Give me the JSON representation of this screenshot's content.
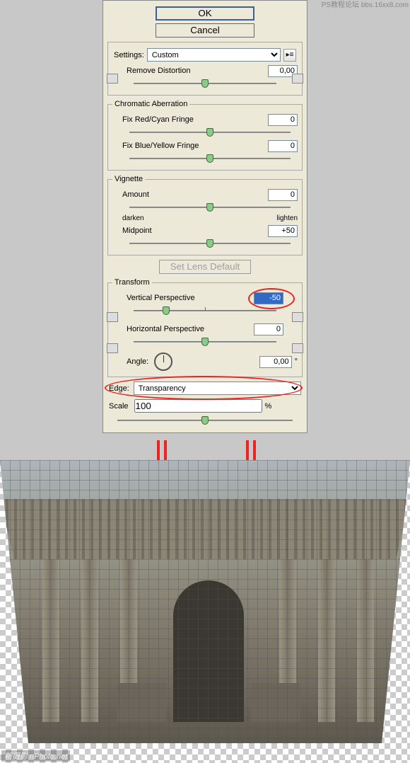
{
  "watermark_top": "PS教程论坛\nbbs.16xx8.com",
  "watermark_bottom": "新摄影 nPhoto.net",
  "buttons": {
    "ok": "OK",
    "cancel": "Cancel"
  },
  "settings": {
    "label": "Settings:",
    "value": "Custom",
    "remove_distortion_label": "Remove Distortion",
    "remove_distortion_value": "0,00"
  },
  "chromatic": {
    "legend": "Chromatic Aberration",
    "red_label": "Fix Red/Cyan Fringe",
    "red_value": "0",
    "blue_label": "Fix Blue/Yellow Fringe",
    "blue_value": "0"
  },
  "vignette": {
    "legend": "Vignette",
    "amount_label": "Amount",
    "amount_value": "0",
    "darken": "darken",
    "lighten": "lighten",
    "midpoint_label": "Midpoint",
    "midpoint_value": "+50"
  },
  "lens_default": "Set Lens Default",
  "transform": {
    "legend": "Transform",
    "vpersp_label": "Vertical Perspective",
    "vpersp_value": "-50",
    "hpersp_label": "Horizontal Perspective",
    "hpersp_value": "0",
    "angle_label": "Angle:",
    "angle_value": "0,00",
    "angle_unit": "°"
  },
  "edge": {
    "label": "Edge:",
    "value": "Transparency"
  },
  "scale": {
    "label": "Scale",
    "value": "100",
    "unit": "%"
  }
}
